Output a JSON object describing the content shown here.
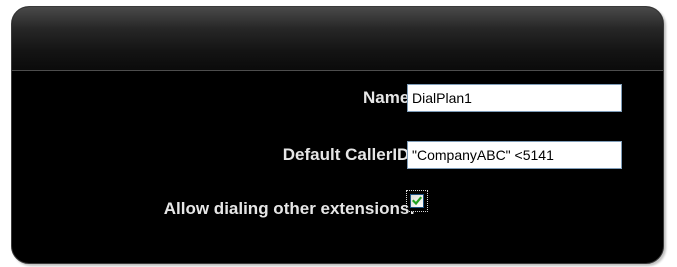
{
  "form": {
    "name_label": "Name:",
    "name_value": "DialPlan1",
    "caller_id_label": "Default CallerID:",
    "caller_id_value": "\"CompanyABC\" <5141",
    "allow_dialing_label": "Allow dialing other extensions:",
    "allow_dialing_checked": true
  },
  "colors": {
    "panel_background": "#000000",
    "label_text": "#e6e6e6",
    "checkmark": "#21a121"
  }
}
